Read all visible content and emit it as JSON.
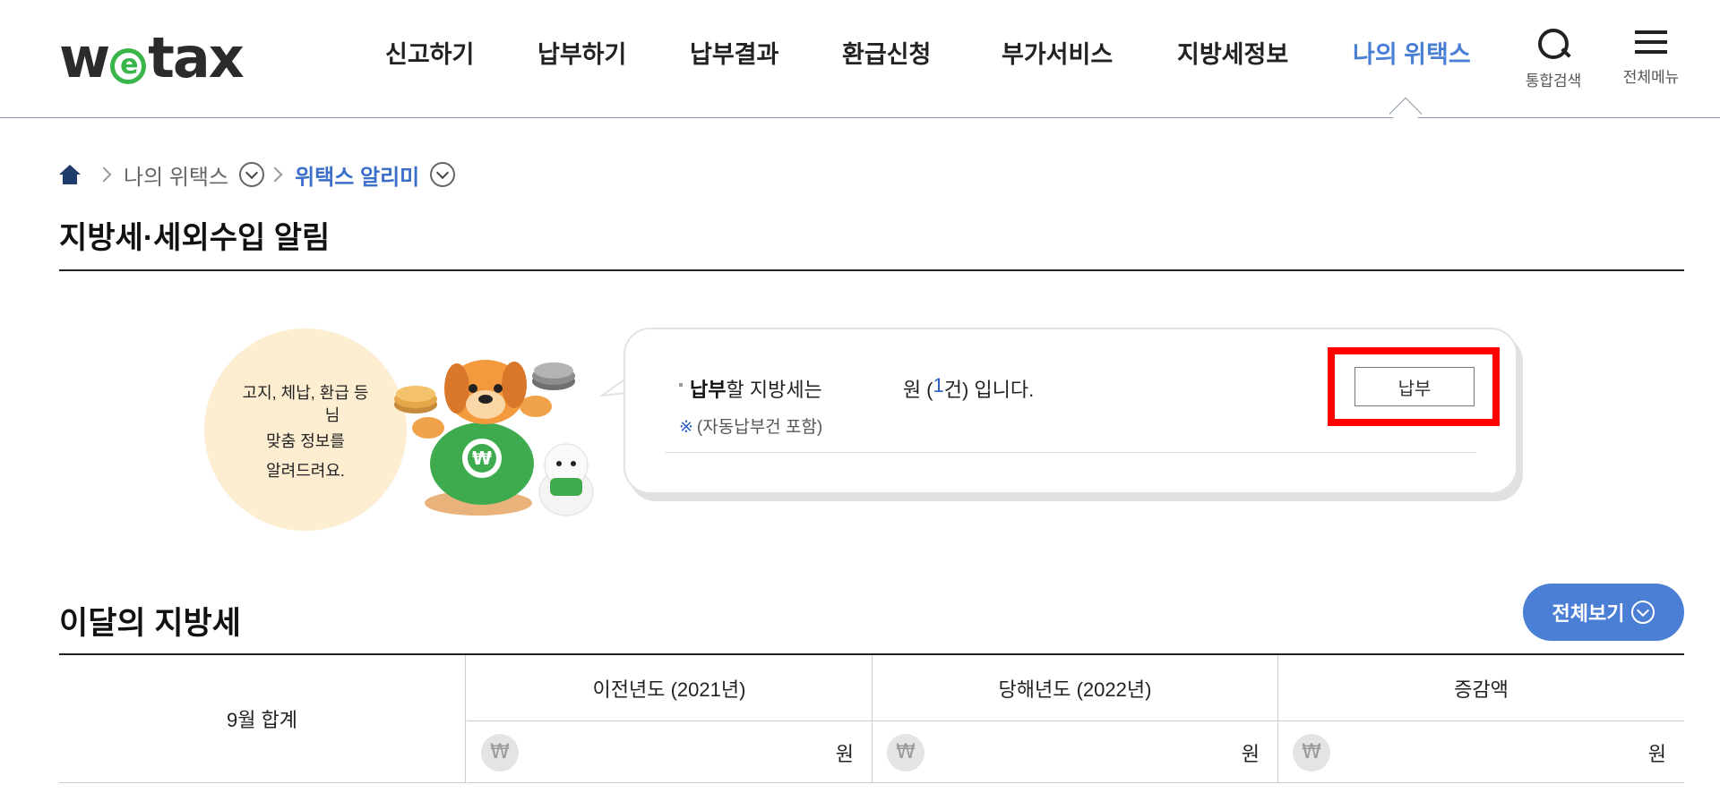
{
  "header": {
    "logo": {
      "pre": "w",
      "e": "e",
      "post": "tax"
    },
    "nav": [
      {
        "label": "신고하기"
      },
      {
        "label": "납부하기"
      },
      {
        "label": "납부결과"
      },
      {
        "label": "환급신청"
      },
      {
        "label": "부가서비스"
      },
      {
        "label": "지방세정보"
      },
      {
        "label": "나의 위택스",
        "active": true
      }
    ],
    "search_label": "통합검색",
    "menu_label": "전체메뉴"
  },
  "breadcrumb": {
    "item1": "나의 위택스",
    "item2": "위택스 알리미"
  },
  "page_title": "지방세·세외수입 알림",
  "notice": {
    "bubble_lines": [
      "고지, 체납, 환급 등",
      "님",
      "맞춤 정보를",
      "알려드려요."
    ],
    "line_bold": "납부",
    "line_text": "할 지방세는",
    "line_unit": "원 (",
    "line_count": "1",
    "line_tail": "건) 입니다.",
    "note_mark": "※",
    "note_text": "(자동납부건 포함)",
    "pay_button": "납부"
  },
  "monthly": {
    "title": "이달의 지방세",
    "view_all": "전체보기",
    "row_label": "9월 합계",
    "columns": [
      "이전년도 (2021년)",
      "당해년도 (2022년)",
      "증감액"
    ],
    "currency_symbol": "₩",
    "unit": "원"
  },
  "colors": {
    "accent": "#4b7fd6",
    "logo_green": "#39b54a",
    "highlight": "#ff0000",
    "bubble_bg": "#fdeed2"
  }
}
